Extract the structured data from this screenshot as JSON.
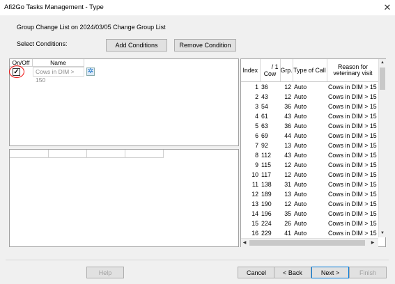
{
  "window": {
    "title": "Afi2Go Tasks Management - Type",
    "close_icon": "close-icon"
  },
  "header": {
    "list_title": "Group Change List on 2024/03/05 Change Group List",
    "select_conditions_label": "Select Conditions:",
    "add_conditions_label": "Add Conditions",
    "remove_condition_label": "Remove Condition"
  },
  "conditions": {
    "columns": {
      "onoff": "On/Off",
      "name": "Name"
    },
    "rows": [
      {
        "checked": true,
        "checkmark": "✓",
        "name": "Cows in DIM > 150",
        "gear_glyph": "✲"
      }
    ]
  },
  "animals": {
    "columns": {
      "index": "Index",
      "cow_top": "/ 1",
      "cow": "Cow",
      "grp": "Grp.",
      "type_of_call": "Type of Call",
      "reason": "Reason for veterinary visit"
    },
    "rows": [
      {
        "index": "1",
        "cow": "36",
        "grp": "12",
        "type": "Auto",
        "reason": "Cows in DIM > 15"
      },
      {
        "index": "2",
        "cow": "43",
        "grp": "12",
        "type": "Auto",
        "reason": "Cows in DIM > 15"
      },
      {
        "index": "3",
        "cow": "54",
        "grp": "36",
        "type": "Auto",
        "reason": "Cows in DIM > 15"
      },
      {
        "index": "4",
        "cow": "61",
        "grp": "43",
        "type": "Auto",
        "reason": "Cows in DIM > 15"
      },
      {
        "index": "5",
        "cow": "63",
        "grp": "36",
        "type": "Auto",
        "reason": "Cows in DIM > 15"
      },
      {
        "index": "6",
        "cow": "69",
        "grp": "44",
        "type": "Auto",
        "reason": "Cows in DIM > 15"
      },
      {
        "index": "7",
        "cow": "92",
        "grp": "13",
        "type": "Auto",
        "reason": "Cows in DIM > 15"
      },
      {
        "index": "8",
        "cow": "112",
        "grp": "43",
        "type": "Auto",
        "reason": "Cows in DIM > 15"
      },
      {
        "index": "9",
        "cow": "115",
        "grp": "12",
        "type": "Auto",
        "reason": "Cows in DIM > 15"
      },
      {
        "index": "10",
        "cow": "117",
        "grp": "12",
        "type": "Auto",
        "reason": "Cows in DIM > 15"
      },
      {
        "index": "11",
        "cow": "138",
        "grp": "31",
        "type": "Auto",
        "reason": "Cows in DIM > 15"
      },
      {
        "index": "12",
        "cow": "189",
        "grp": "13",
        "type": "Auto",
        "reason": "Cows in DIM > 15"
      },
      {
        "index": "13",
        "cow": "190",
        "grp": "12",
        "type": "Auto",
        "reason": "Cows in DIM > 15"
      },
      {
        "index": "14",
        "cow": "196",
        "grp": "35",
        "type": "Auto",
        "reason": "Cows in DIM > 15"
      },
      {
        "index": "15",
        "cow": "224",
        "grp": "26",
        "type": "Auto",
        "reason": "Cows in DIM > 15"
      },
      {
        "index": "16",
        "cow": "229",
        "grp": "41",
        "type": "Auto",
        "reason": "Cows in DIM > 15"
      }
    ],
    "scroll_up_glyph": "▲",
    "scroll_down_glyph": "▼",
    "scroll_left_glyph": "◀",
    "scroll_right_glyph": "▶"
  },
  "footer": {
    "help_label": "Help",
    "cancel_label": "Cancel",
    "back_label": "< Back",
    "next_label": "Next >",
    "finish_label": "Finish"
  }
}
